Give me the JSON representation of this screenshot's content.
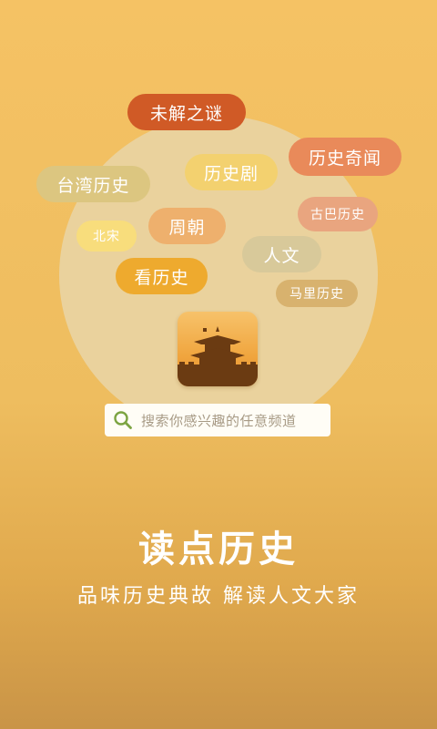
{
  "tags": [
    {
      "id": "weijie",
      "label": "未解之谜",
      "bg": "#d05a26",
      "fg": "#ffffff"
    },
    {
      "id": "qiwen",
      "label": "历史奇闻",
      "bg": "#e98a5a",
      "fg": "#ffffff"
    },
    {
      "id": "taiwan",
      "label": "台湾历史",
      "bg": "#dcc680",
      "fg": "#ffffff"
    },
    {
      "id": "lishiju",
      "label": "历史剧",
      "bg": "#f3d16f",
      "fg": "#ffffff"
    },
    {
      "id": "guba",
      "label": "古巴历史",
      "bg": "#e9a57f",
      "fg": "#ffffff"
    },
    {
      "id": "beisong",
      "label": "北宋",
      "bg": "#f8dd7c",
      "fg": "#ffffff"
    },
    {
      "id": "zhouchao",
      "label": "周朝",
      "bg": "#eeb06d",
      "fg": "#ffffff"
    },
    {
      "id": "renwen",
      "label": "人文",
      "bg": "#d8c99a",
      "fg": "#ffffff"
    },
    {
      "id": "kanlishi",
      "label": "看历史",
      "bg": "#eeaa2e",
      "fg": "#ffffff"
    },
    {
      "id": "mali",
      "label": "马里历史",
      "bg": "#d8b26e",
      "fg": "#ffffff"
    }
  ],
  "search": {
    "placeholder": "搜索你感兴趣的任意频道"
  },
  "title": "读点历史",
  "subtitle": "品味历史典故 解读人文大家",
  "colors": {
    "accent": "#f5c264",
    "lamp": "#ead29d",
    "logo": "#f0a53e"
  }
}
